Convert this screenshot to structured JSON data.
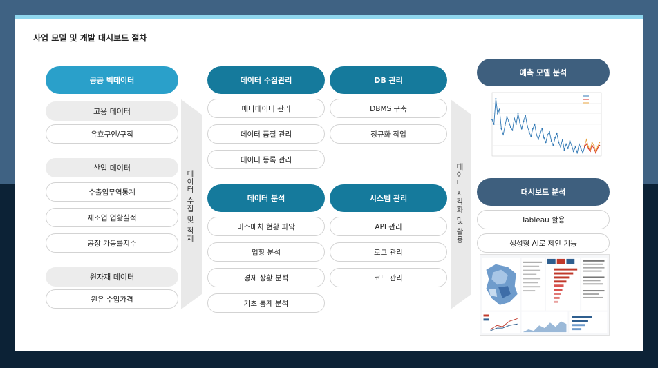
{
  "title": "사업 모델 및 개발 대시보드 절차",
  "col1": {
    "header": "공공 빅데이터",
    "groups": [
      {
        "category": "고용 데이터",
        "items": [
          "유효구인/구직"
        ]
      },
      {
        "category": "산업 데이터",
        "items": [
          "수출입무역통계",
          "제조업 업황실적",
          "공장 가동률지수"
        ]
      },
      {
        "category": "원자재 데이터",
        "items": [
          "원유 수입가격"
        ]
      }
    ]
  },
  "arrow1_label": "데이터 수집 및 적재",
  "col2": {
    "collect": {
      "header": "데이터 수집관리",
      "items": [
        "메타데이터 관리",
        "데이터 품질 관리",
        "데이터 등록 관리"
      ]
    },
    "analysis": {
      "header": "데이터 분석",
      "items": [
        "미스매치 현황 파악",
        "업황 분석",
        "경제 상황 분석",
        "기초 통계 분석"
      ]
    }
  },
  "col3": {
    "db": {
      "header": "DB 관리",
      "items": [
        "DBMS 구축",
        "정규화 작업"
      ]
    },
    "system": {
      "header": "시스템 관리",
      "items": [
        "API 관리",
        "로그 관리",
        "코드 관리"
      ]
    }
  },
  "arrow2_label": "데이터 시각화 및 활용",
  "col4": {
    "forecast": {
      "header": "예측 모델 분석"
    },
    "dashboard": {
      "header": "대시보드 분석",
      "items": [
        "Tableau 활용",
        "생성형 AI로 제안 기능"
      ]
    }
  },
  "colors": {
    "light_blue": "#2aa0ca",
    "teal": "#157a9c",
    "navy": "#3e5f7e",
    "series_train": "#2f77b4",
    "series_predict": "#d62728",
    "series_test": "#e8a33d"
  },
  "chart_data": {
    "type": "line",
    "legend_position": "top-right",
    "grid": true,
    "series": [
      {
        "values": [
          4.2,
          3.9,
          5.6,
          4.6,
          4.9,
          3.6,
          3.2,
          3.8,
          4.4,
          4.1,
          3.7,
          3.5,
          4.3,
          3.9,
          4.6,
          4.0,
          3.6,
          4.1,
          4.5,
          3.8,
          3.4,
          3.1,
          3.6,
          3.9,
          3.2,
          2.9,
          3.3,
          3.6,
          3.0,
          2.7,
          3.2,
          3.4,
          2.8,
          2.5,
          3.0,
          3.3,
          2.7,
          2.4,
          2.9,
          2.2,
          2.6,
          2.3,
          2.8,
          2.5,
          2.1,
          2.4,
          2.0,
          2.6,
          2.3,
          2.0,
          2.4
        ]
      },
      {
        "values": [
          2.4,
          2.6,
          2.3,
          2.1,
          2.5,
          2.3,
          2.0,
          2.3,
          2.5
        ]
      },
      {
        "values": [
          2.5,
          2.9,
          2.4,
          2.2,
          2.7,
          2.5,
          2.1,
          2.4,
          2.7
        ]
      }
    ],
    "x_range": [
      0,
      59
    ],
    "y_range": [
      1.8,
      6.0
    ]
  }
}
